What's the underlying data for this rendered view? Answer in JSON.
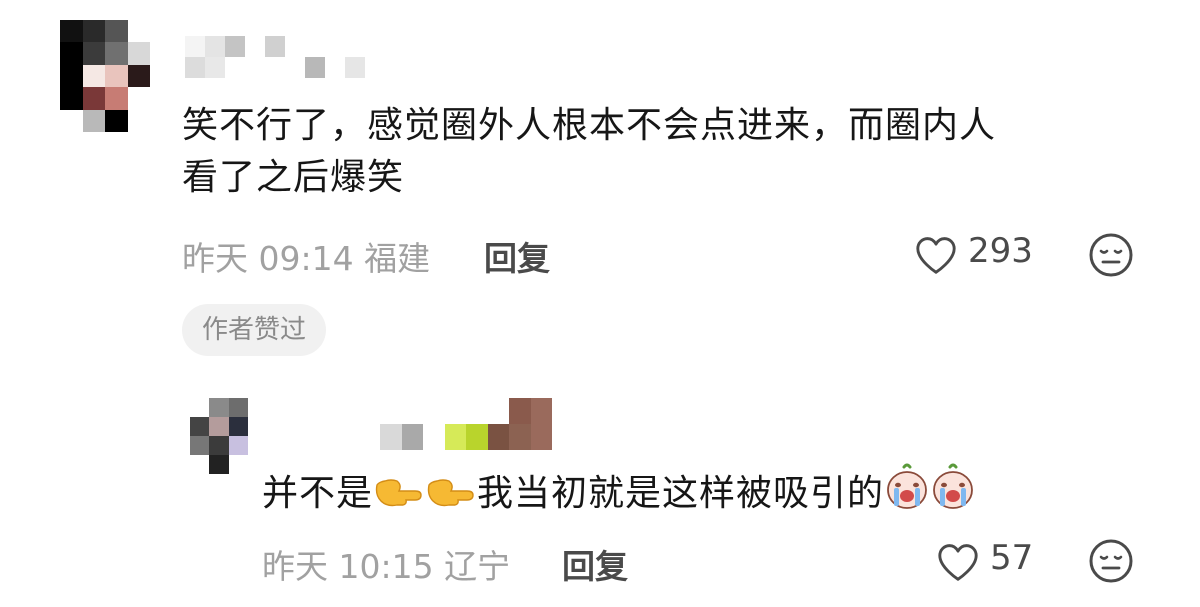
{
  "comment": {
    "text_line1": "笑不行了，感觉圈外人根本不会点进来，而圈内人",
    "text_line2": "看了之后爆笑",
    "time": "昨天 09:14",
    "location": "福建",
    "reply_label": "回复",
    "likes": "293",
    "author_liked_badge": "作者赞过",
    "icons": {
      "like": "heart-outline-icon",
      "more": "neutral-face-icon"
    }
  },
  "reply": {
    "text_before": "并不是",
    "text_middle": "我当初就是这样被吸引的",
    "emoji_pointing": "backhand-index-pointing-right",
    "emoji_crying": "crying-peach-sticker",
    "time": "昨天 10:15",
    "location": "辽宁",
    "reply_label": "回复",
    "likes": "57",
    "icons": {
      "like": "heart-outline-icon",
      "more": "neutral-face-icon"
    }
  },
  "colors": {
    "text": "#161616",
    "meta": "#a1a1a1",
    "badge_bg": "#f1f1f1",
    "badge_text": "#8a8a8a"
  }
}
